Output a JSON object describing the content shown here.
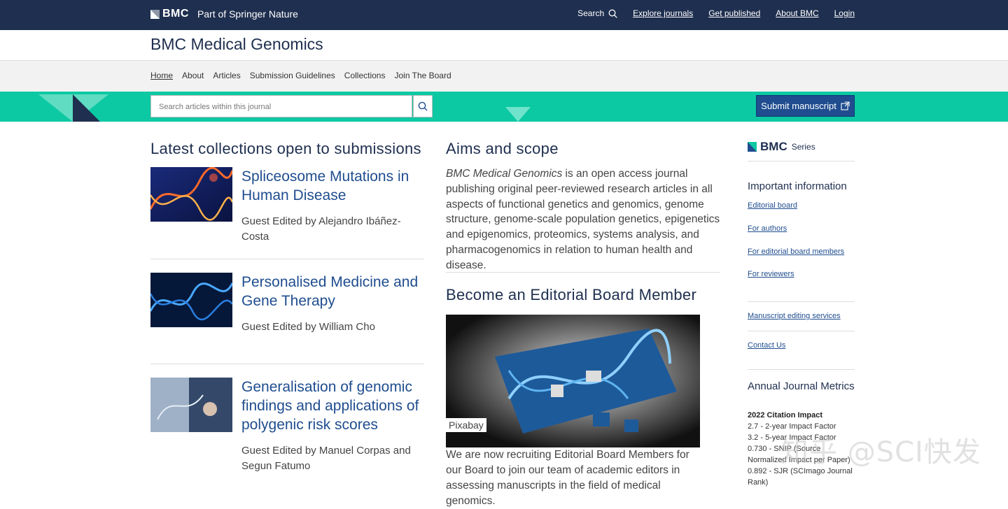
{
  "topbar": {
    "logo_text": "BMC",
    "logo_sub": "Part of Springer Nature",
    "search_label": "Search",
    "nav": [
      "Explore journals",
      "Get published",
      "About BMC",
      "Login"
    ]
  },
  "journal_title": "BMC Medical Genomics",
  "subnav": [
    "Home",
    "About",
    "Articles",
    "Submission Guidelines",
    "Collections",
    "Join The Board"
  ],
  "search": {
    "placeholder": "Search articles within this journal"
  },
  "submit_label": "Submit manuscript",
  "left": {
    "heading": "Latest collections open to submissions",
    "collections": [
      {
        "title": "Spliceosome Mutations in Human Disease",
        "editor": "Guest Edited by Alejandro Ibáñez-Costa"
      },
      {
        "title": "Personalised Medicine and Gene Therapy",
        "editor": "Guest Edited by William Cho"
      },
      {
        "title": "Generalisation of genomic findings and applications of polygenic risk scores",
        "editor": "Guest Edited by Manuel Corpas and Segun Fatumo"
      }
    ]
  },
  "middle": {
    "aims_heading": "Aims and scope",
    "aims_journal": "BMC Medical Genomics",
    "aims_text": " is an open access journal publishing original peer-reviewed research articles in all aspects of functional genetics and genomics, genome structure, genome-scale population genetics, epigenetics and epigenomics, proteomics, systems analysis, and pharmacogenomics in relation to human health and disease.",
    "board_heading": "Become an Editorial Board Member",
    "image_credit": "Pixabay",
    "recruit_text": "We are now recruiting Editorial Board Members for our Board to join our team of academic editors in assessing manuscripts in the field of medical genomics."
  },
  "right": {
    "series_logo": "BMC",
    "series_word": "Series",
    "info_heading": "Important information",
    "links": [
      "Editorial board",
      "For authors",
      "For editorial board members",
      "For reviewers"
    ],
    "manuscript_editing": "Manuscript editing services",
    "contact": "Contact Us",
    "metrics_heading": "Annual Journal Metrics",
    "citation_heading": "2022 Citation Impact",
    "metrics": [
      "2.7 - 2-year Impact Factor",
      "3.2 - 5-year Impact Factor",
      "0.730 - SNIP (Source Normalized Impact per Paper)",
      "0.892 - SJR (SCImago Journal Rank)"
    ]
  },
  "watermark": "知乎 @SCI快发"
}
